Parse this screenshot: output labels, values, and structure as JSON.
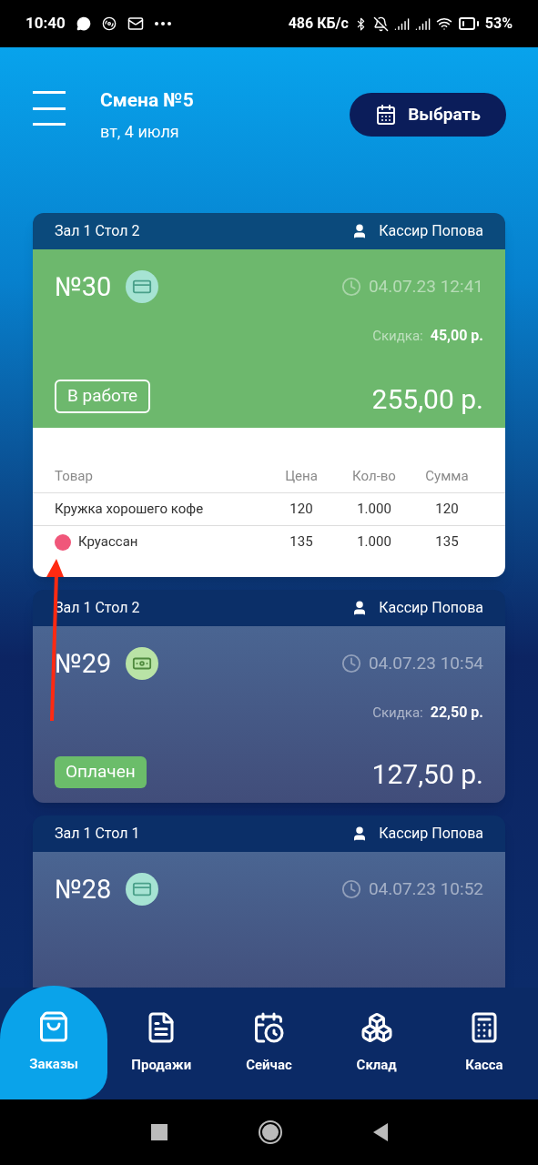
{
  "status_bar": {
    "time": "10:40",
    "speed": "486 КБ/с",
    "battery": "53%"
  },
  "header": {
    "title": "Смена №5",
    "subtitle": "вт, 4 июля",
    "button": "Выбрать"
  },
  "orders": [
    {
      "location": "Зал 1 Стол 2",
      "cashier": "Кассир Попова",
      "number": "№30",
      "kind": "card",
      "datetime": "04.07.23 12:41",
      "discount_label": "Скидка:",
      "discount": "45,00 р.",
      "total": "255,00 р.",
      "highlighted": true,
      "status": {
        "label": "В работе",
        "kind": "outline"
      },
      "table": {
        "columns": [
          "Товар",
          "Цена",
          "Кол-во",
          "Сумма"
        ],
        "rows": [
          {
            "name": "Кружка хорошего кофе",
            "price": "120",
            "qty": "1.000",
            "sum": "120",
            "flagged": false
          },
          {
            "name": "Круассан",
            "price": "135",
            "qty": "1.000",
            "sum": "135",
            "flagged": true
          }
        ]
      }
    },
    {
      "location": "Зал 1 Стол 2",
      "cashier": "Кассир Попова",
      "number": "№29",
      "kind": "cash",
      "datetime": "04.07.23 10:54",
      "discount_label": "Скидка:",
      "discount": "22,50 р.",
      "total": "127,50 р.",
      "highlighted": false,
      "status": {
        "label": "Оплачен",
        "kind": "filled"
      }
    },
    {
      "location": "Зал 1 Стол 1",
      "cashier": "Кассир Попова",
      "number": "№28",
      "kind": "card",
      "datetime": "04.07.23 10:52",
      "highlighted": false
    }
  ],
  "nav": [
    {
      "label": "Заказы",
      "kind": "bag",
      "selected": true
    },
    {
      "label": "Продажи",
      "kind": "doc",
      "selected": false
    },
    {
      "label": "Сейчас",
      "kind": "calclock",
      "selected": false
    },
    {
      "label": "Склад",
      "kind": "boxes",
      "selected": false
    },
    {
      "label": "Касса",
      "kind": "register",
      "selected": false
    }
  ]
}
